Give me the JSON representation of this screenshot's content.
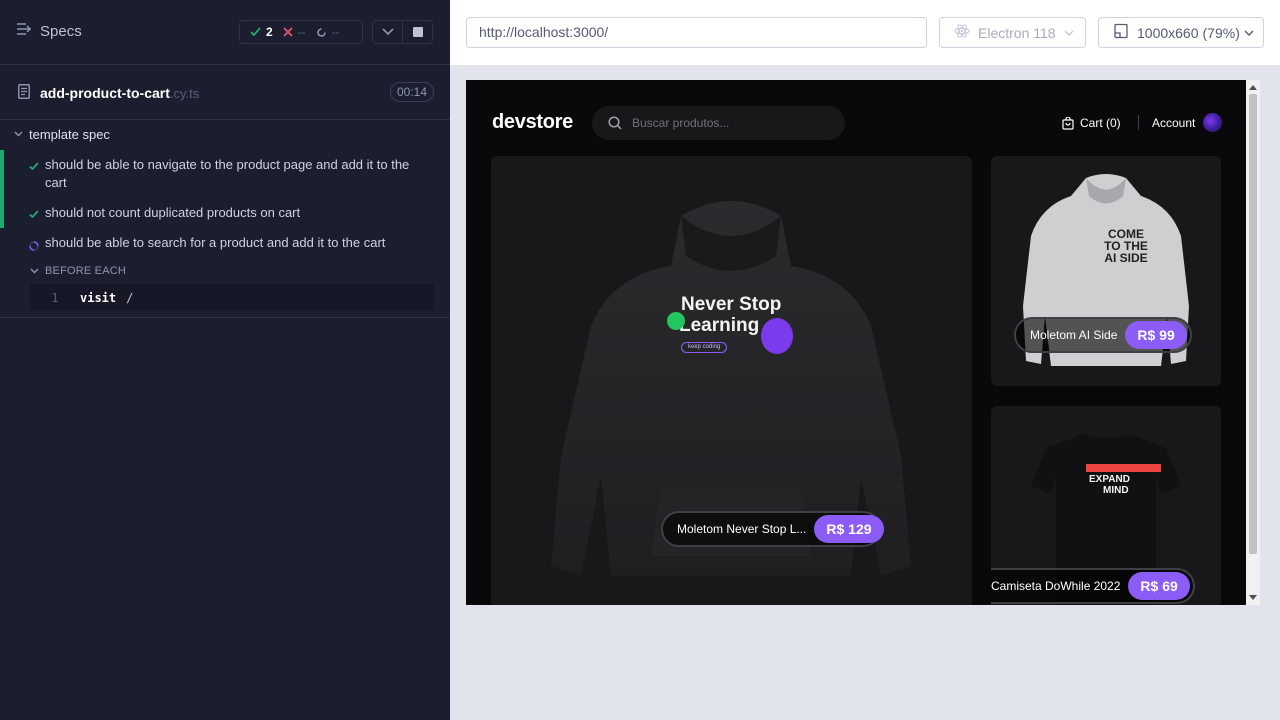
{
  "runner": {
    "specs_label": "Specs",
    "stats": {
      "passed": "2",
      "failed": "--",
      "pending": "--"
    },
    "spec_file": {
      "name": "add-product-to-cart",
      "ext": ".cy.ts",
      "duration": "00:14"
    },
    "suite": {
      "title": "template spec",
      "tests": [
        {
          "title": "should be able to navigate to the product page and add it to the cart",
          "state": "passed"
        },
        {
          "title": "should not count duplicated products on cart",
          "state": "passed"
        },
        {
          "title": "should be able to search for a product and add it to the cart",
          "state": "running"
        }
      ],
      "hook_label": "BEFORE EACH",
      "command": {
        "num": "1",
        "name": "visit",
        "arg": "/"
      }
    }
  },
  "browser": {
    "url": "http://localhost:3000/",
    "browser_name": "Electron 118",
    "viewport": "1000x660",
    "zoom": "(79%)"
  },
  "app": {
    "logo": "devstore",
    "search_placeholder": "Buscar produtos...",
    "cart_label": "Cart (0)",
    "account_label": "Account",
    "products": [
      {
        "name": "Moletom Never Stop L...",
        "price": "R$ 129",
        "print_line1": "Never Stop",
        "print_line2": "Learning",
        "print_small": "keep coding"
      },
      {
        "name": "Moletom AI Side",
        "price": "R$ 99",
        "print_line1": "COME",
        "print_line2": "TO THE",
        "print_line3": "AI SIDE"
      },
      {
        "name": "Camiseta DoWhile 2022",
        "price": "R$ 69",
        "print_line1": "EXPAND",
        "print_line2": "MIND"
      }
    ]
  },
  "colors": {
    "runner_bg": "#1b1e2e",
    "pass": "#1fa971",
    "fail": "#e45770",
    "accent": "#8b5cf6",
    "app_bg": "#09090b"
  }
}
